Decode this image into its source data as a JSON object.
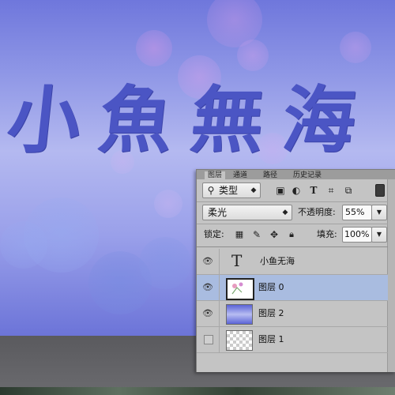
{
  "artwork": {
    "title_text": "小魚無海"
  },
  "layers_panel": {
    "tabs": [
      "图层",
      "通道",
      "路径",
      "历史记录"
    ],
    "filter": {
      "label": "类型",
      "icons": [
        "image-filter-icon",
        "adjustment-filter-icon",
        "type-filter-icon",
        "shape-filter-icon",
        "smart-object-filter-icon"
      ]
    },
    "blend_mode": "柔光",
    "opacity": {
      "label": "不透明度:",
      "value": "55%"
    },
    "lock": {
      "label": "锁定:",
      "icons": [
        "lock-transparent-icon",
        "lock-image-icon",
        "lock-position-icon",
        "lock-all-icon"
      ]
    },
    "fill": {
      "label": "填充:",
      "value": "100%"
    },
    "layers": [
      {
        "name": "小鱼无海",
        "kind": "text",
        "visible": true,
        "selected": false,
        "thumb_glyph": "T"
      },
      {
        "name": "图层 0",
        "kind": "image",
        "visible": true,
        "selected": true
      },
      {
        "name": "图层 2",
        "kind": "gradient",
        "visible": true,
        "selected": false
      },
      {
        "name": "图层 1",
        "kind": "transparent",
        "visible": false,
        "selected": false
      }
    ]
  },
  "colors": {
    "accent_text": "#4b55c4",
    "selection": "#a9bce0",
    "panel_bg": "#c4c4c4"
  }
}
